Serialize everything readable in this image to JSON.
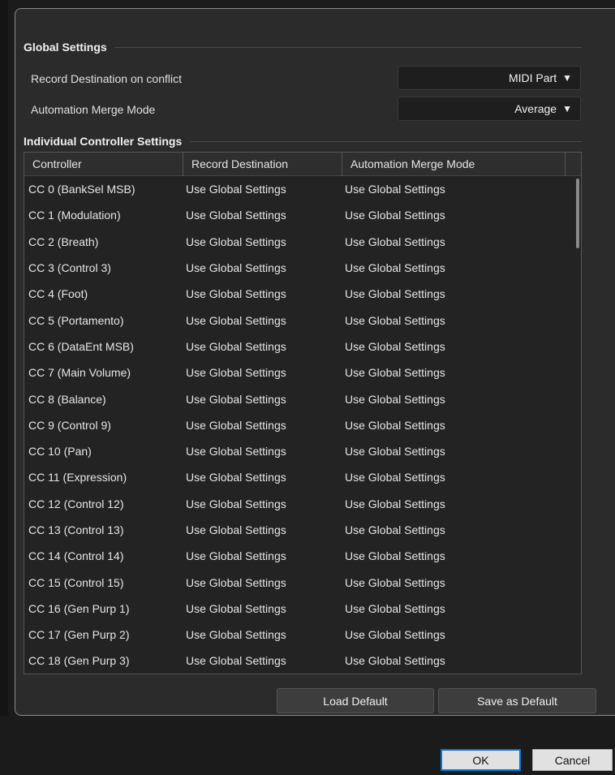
{
  "global_settings": {
    "title": "Global Settings",
    "record_destination": {
      "label": "Record Destination on conflict",
      "value": "MIDI Part"
    },
    "automation_merge_mode": {
      "label": "Automation Merge Mode",
      "value": "Average"
    }
  },
  "individual": {
    "title": "Individual Controller Settings",
    "columns": [
      "Controller",
      "Record Destination",
      "Automation Merge Mode"
    ],
    "rows": [
      [
        "CC 0  (BankSel MSB)",
        "Use Global Settings",
        "Use Global Settings"
      ],
      [
        "CC 1  (Modulation)",
        "Use Global Settings",
        "Use Global Settings"
      ],
      [
        "CC 2  (Breath)",
        "Use Global Settings",
        "Use Global Settings"
      ],
      [
        "CC 3  (Control 3)",
        "Use Global Settings",
        "Use Global Settings"
      ],
      [
        "CC 4  (Foot)",
        "Use Global Settings",
        "Use Global Settings"
      ],
      [
        "CC 5  (Portamento)",
        "Use Global Settings",
        "Use Global Settings"
      ],
      [
        "CC 6  (DataEnt MSB)",
        "Use Global Settings",
        "Use Global Settings"
      ],
      [
        "CC 7  (Main Volume)",
        "Use Global Settings",
        "Use Global Settings"
      ],
      [
        "CC 8  (Balance)",
        "Use Global Settings",
        "Use Global Settings"
      ],
      [
        "CC 9  (Control 9)",
        "Use Global Settings",
        "Use Global Settings"
      ],
      [
        "CC 10  (Pan)",
        "Use Global Settings",
        "Use Global Settings"
      ],
      [
        "CC 11  (Expression)",
        "Use Global Settings",
        "Use Global Settings"
      ],
      [
        "CC 12  (Control 12)",
        "Use Global Settings",
        "Use Global Settings"
      ],
      [
        "CC 13  (Control 13)",
        "Use Global Settings",
        "Use Global Settings"
      ],
      [
        "CC 14  (Control 14)",
        "Use Global Settings",
        "Use Global Settings"
      ],
      [
        "CC 15  (Control 15)",
        "Use Global Settings",
        "Use Global Settings"
      ],
      [
        "CC 16  (Gen Purp 1)",
        "Use Global Settings",
        "Use Global Settings"
      ],
      [
        "CC 17  (Gen Purp 2)",
        "Use Global Settings",
        "Use Global Settings"
      ],
      [
        "CC 18  (Gen Purp 3)",
        "Use Global Settings",
        "Use Global Settings"
      ]
    ]
  },
  "buttons": {
    "load_default": "Load Default",
    "save_as_default": "Save as Default",
    "ok": "OK",
    "cancel": "Cancel"
  },
  "icons": {
    "dropdown": "caret-down-icon"
  }
}
